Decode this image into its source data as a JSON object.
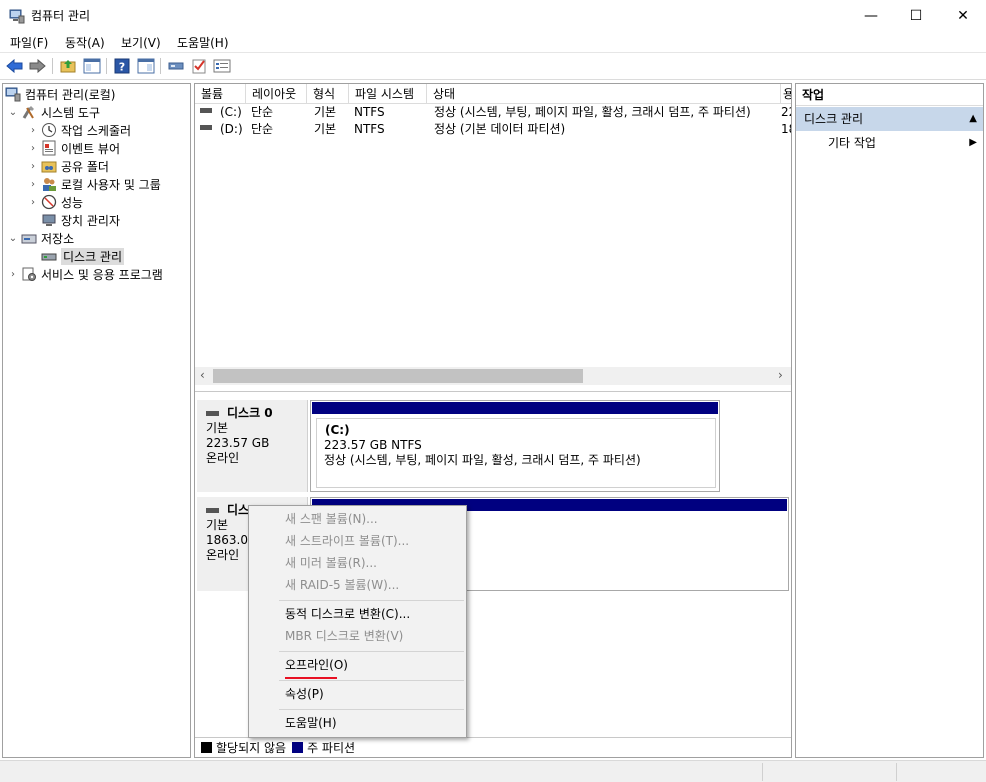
{
  "window": {
    "title": "컴퓨터 관리",
    "minimize_glyph": "—",
    "maximize_glyph": "☐",
    "close_glyph": "✕"
  },
  "menu": [
    "파일(F)",
    "동작(A)",
    "보기(V)",
    "도움말(H)"
  ],
  "toolbar_icons": [
    "back-arrow-icon",
    "forward-arrow-icon",
    "up-folder-icon",
    "show-hide-tree-icon",
    "help-icon",
    "show-hide-action-icon",
    "connect-icon",
    "check-icon",
    "properties-icon"
  ],
  "tree": {
    "root": "컴퓨터 관리(로컬)",
    "system_tools": "시스템 도구",
    "task_scheduler": "작업 스케줄러",
    "event_viewer": "이벤트 뷰어",
    "shared_folders": "공유 폴더",
    "local_users": "로컬 사용자 및 그룹",
    "performance": "성능",
    "device_manager": "장치 관리자",
    "storage": "저장소",
    "disk_management": "디스크 관리",
    "services": "서비스 및 응용 프로그램"
  },
  "volume_list": {
    "columns": [
      "볼륨",
      "레이아웃",
      "형식",
      "파일 시스템",
      "상태",
      "용"
    ],
    "rows": [
      {
        "volume": "(C:)",
        "layout": "단순",
        "type": "기본",
        "fs": "NTFS",
        "status": "정상 (시스템, 부팅, 페이지 파일, 활성, 크래시 덤프, 주 파티션)",
        "cap": "22"
      },
      {
        "volume": "(D:)",
        "layout": "단순",
        "type": "기본",
        "fs": "NTFS",
        "status": "정상 (기본 데이터 파티션)",
        "cap": "18"
      }
    ]
  },
  "disks": [
    {
      "name": "디스크 0",
      "type": "기본",
      "size": "223.57 GB",
      "state": "온라인",
      "partition": {
        "label": "(C:)",
        "size_fs": "223.57 GB NTFS",
        "status": "정상 (시스템, 부팅, 페이지 파일, 활성, 크래시 덤프, 주 파티션)"
      }
    },
    {
      "name": "디스",
      "type": "기본",
      "size": "1863.02",
      "state": "온라인"
    }
  ],
  "legend": {
    "unallocated": "할당되지 않음",
    "primary": "주 파티션",
    "unallocated_color": "#000000",
    "primary_color": "#000080"
  },
  "actions": {
    "header": "작업",
    "section": "디스크 관리",
    "item": "기타 작업"
  },
  "context_menu": {
    "items": [
      {
        "label": "새 스팬 볼륨(N)...",
        "enabled": false
      },
      {
        "label": "새 스트라이프 볼륨(T)...",
        "enabled": false
      },
      {
        "label": "새 미러 볼륨(R)...",
        "enabled": false
      },
      {
        "label": "새 RAID-5 볼륨(W)...",
        "enabled": false
      },
      {
        "label": "동적 디스크로 변환(C)...",
        "enabled": true
      },
      {
        "label": "MBR 디스크로 변환(V)",
        "enabled": false
      },
      {
        "label": "오프라인(O)",
        "enabled": true
      },
      {
        "label": "속성(P)",
        "enabled": true
      },
      {
        "label": "도움말(H)",
        "enabled": true
      }
    ],
    "highlight_color": "#e81123"
  }
}
